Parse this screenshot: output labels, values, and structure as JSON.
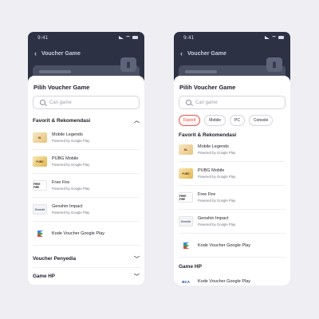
{
  "status_time": "9:41",
  "app_title": "Voucher Game",
  "sheet_title": "Pilih Voucher Game",
  "search_placeholder": "Cari game",
  "chips": [
    {
      "label": "Favorit",
      "active": true
    },
    {
      "label": "Mobile",
      "active": false
    },
    {
      "label": "PC",
      "active": false
    },
    {
      "label": "Console",
      "active": false
    }
  ],
  "favorites_heading": "Favorit & Rekomendasi",
  "items": [
    {
      "name": "Mobile Legends",
      "sub": "Powered by Google Play",
      "thumb": "ML"
    },
    {
      "name": "PUBG Mobile",
      "sub": "Powered by Google Play",
      "thumb": "PUBG"
    },
    {
      "name": "Free Fire",
      "sub": "Powered by Google Play",
      "thumb": "FREE FIRE"
    },
    {
      "name": "Genshin Impact",
      "sub": "Powered by Google Play",
      "thumb": "Genshin"
    },
    {
      "name": "Kode Voucher Google Play",
      "sub": "",
      "thumb": ""
    }
  ],
  "voucher_penyedia": "Voucher Penyedia",
  "game_hp": "Game HP",
  "bca_item": {
    "name": "Kode Voucher Google Play",
    "thumb": "BCA"
  },
  "colors": {
    "accent": "#e2584f",
    "header_bg": "#2c3244"
  }
}
